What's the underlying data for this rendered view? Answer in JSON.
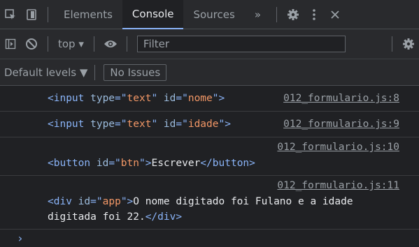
{
  "tabs": {
    "elements": "Elements",
    "console": "Console",
    "sources": "Sources",
    "more": "»"
  },
  "toolbar": {
    "context": "top",
    "filter_placeholder": "Filter"
  },
  "levels": {
    "label": "Default levels ▼",
    "issues": "No Issues"
  },
  "messages": [
    {
      "source": "012_formulario.js:8",
      "parts": [
        "<",
        "input",
        " type",
        "=\"",
        "text",
        "\"",
        " id",
        "=\"",
        "nome",
        "\">"
      ]
    },
    {
      "source": "012_formulario.js:9",
      "parts": [
        "<",
        "input",
        " type",
        "=\"",
        "text",
        "\"",
        " id",
        "=\"",
        "idade",
        "\">"
      ]
    },
    {
      "source": "012_formulario.js:10",
      "line1": [
        "<",
        "button",
        " id",
        "=\"",
        "btn",
        "\">",
        "Escrever",
        "</button>"
      ]
    },
    {
      "source": "012_formulario.js:11",
      "line1": [
        "<",
        "div",
        " id",
        "=\"",
        "app",
        "\">",
        "O nome digitado foi Fulano e a idade"
      ],
      "line2": [
        "digitada foi 22.",
        "</div>"
      ]
    }
  ],
  "prompt": "›"
}
